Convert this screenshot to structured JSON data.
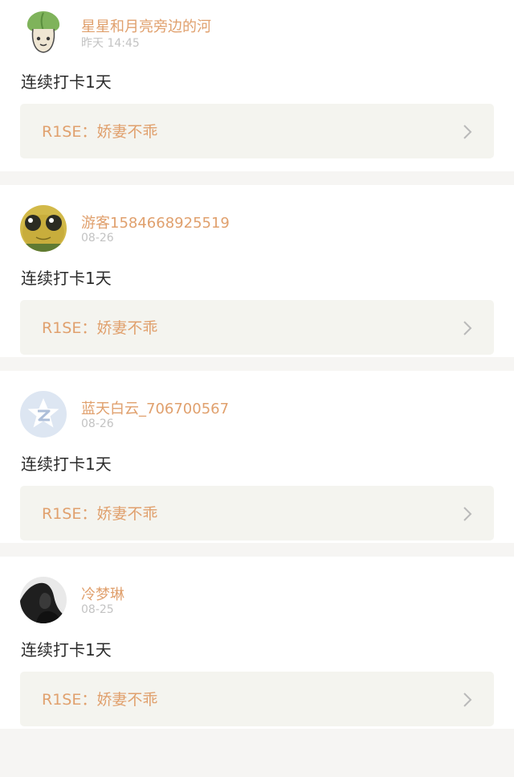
{
  "posts": [
    {
      "username": "星星和月亮旁边的河",
      "time": "昨天 14:45",
      "checkin": "连续打卡1天",
      "song": "R1SE：娇妻不乖",
      "avatar_icon": "bok-choy-cartoon-icon"
    },
    {
      "username": "游客1584668925519",
      "time": "08-26",
      "checkin": "连续打卡1天",
      "song": "R1SE：娇妻不乖",
      "avatar_icon": "frog-cartoon-icon"
    },
    {
      "username": "蓝天白云_706700567",
      "time": "08-26",
      "checkin": "连续打卡1天",
      "song": "R1SE：娇妻不乖",
      "avatar_icon": "default-qq-avatar-icon"
    },
    {
      "username": "冷梦琳",
      "time": "08-25",
      "checkin": "连续打卡1天",
      "song": "R1SE：娇妻不乖",
      "avatar_icon": "photo-avatar-icon"
    }
  ],
  "colors": {
    "accent": "#e0a06d",
    "muted": "#c3c3c3",
    "text": "#2b2b2b",
    "song_bg": "#f4f4ef",
    "page_bg": "#f6f5f3"
  }
}
